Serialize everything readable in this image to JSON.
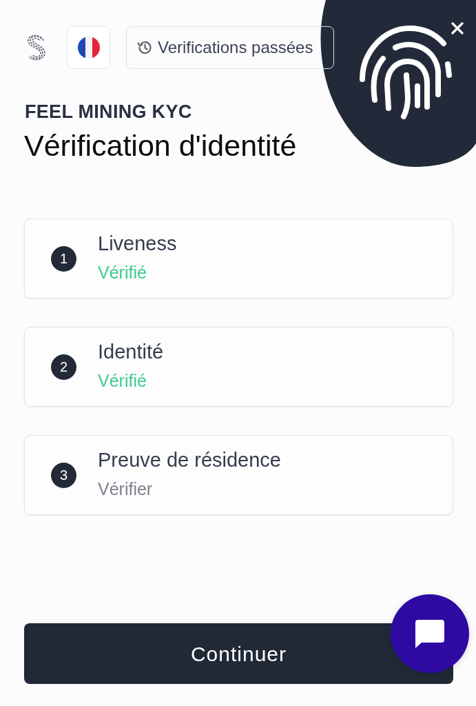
{
  "header": {
    "history_button": {
      "label": "Verifications passées"
    }
  },
  "brand": "FEEL MINING KYC",
  "title": "Vérification d'identité",
  "steps": [
    {
      "number": "1",
      "title": "Liveness",
      "status": "Vérifié",
      "verified": true
    },
    {
      "number": "2",
      "title": "Identité",
      "status": "Vérifié",
      "verified": true
    },
    {
      "number": "3",
      "title": "Preuve de résidence",
      "status": "Vérifier",
      "verified": false
    }
  ],
  "continue_button": {
    "label": "Continuer"
  }
}
